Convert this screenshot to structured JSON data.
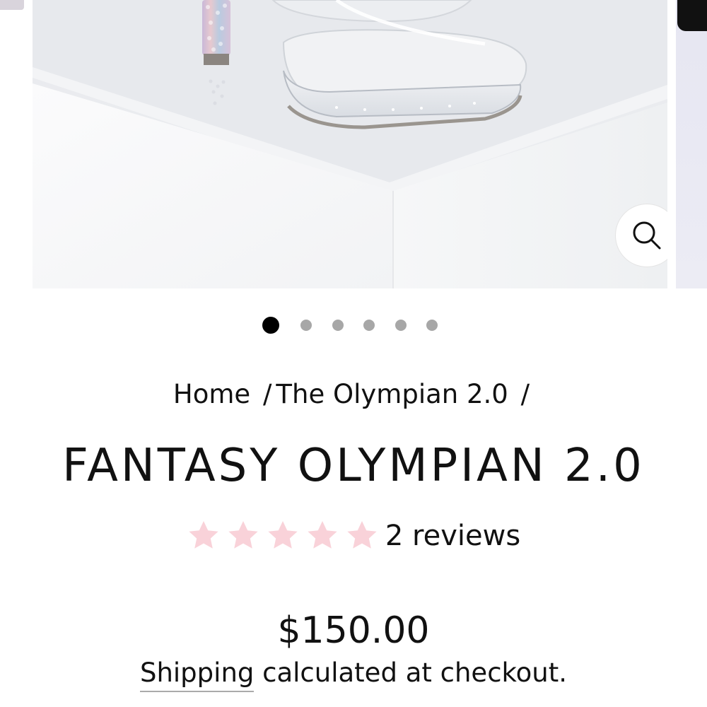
{
  "gallery": {
    "image_alt": "Clear platform heel with crystal-covered heel on white cube",
    "zoom_icon": "search-icon",
    "dots_total": 6,
    "active_dot": 1
  },
  "breadcrumb": {
    "home": "Home",
    "sep1": "/",
    "collection": "The Olympian 2.0",
    "sep2": "/"
  },
  "product": {
    "title": "FANTASY OLYMPIAN 2.0",
    "rating_stars": 5,
    "reviews_label": "2 reviews",
    "price": "$150.00",
    "shipping_link": "Shipping",
    "shipping_rest": " calculated at checkout."
  },
  "colors": {
    "star": "#f9d2d9",
    "text": "#111111",
    "active_dot": "#000000",
    "inactive_dot": "#a7a7a7"
  }
}
